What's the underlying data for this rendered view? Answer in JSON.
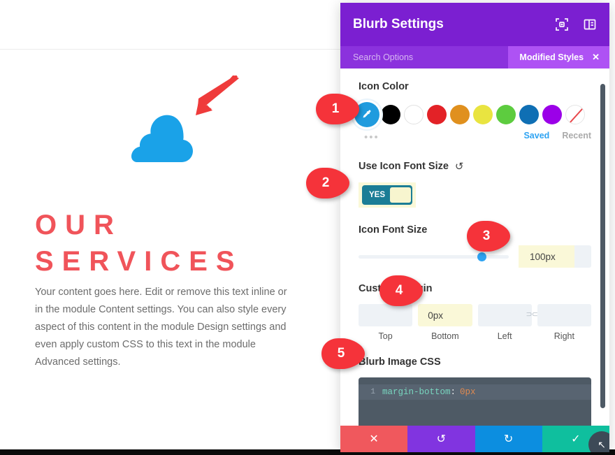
{
  "page": {
    "heading": "OUR SERVICES",
    "heading_line1": "OUR",
    "heading_line2": "SERVICES",
    "body": "Your content goes here. Edit or remove this text inline or in the module Content settings. You can also style every aspect of this content in the module Design settings and even apply custom CSS to this text in the module Advanced settings.",
    "heading_color": "#f0545a",
    "icon_name": "cloud-icon",
    "icon_color": "#1aa2e8"
  },
  "panel": {
    "title": "Blurb Settings",
    "header_color": "#7b1fd1",
    "icons": [
      {
        "name": "expand-icon"
      },
      {
        "name": "layout-columns-icon"
      }
    ],
    "search_placeholder": "Search Options",
    "modified_styles_label": "Modified Styles",
    "modified_styles_close": "✕"
  },
  "icon_color": {
    "label": "Icon Color",
    "swatches": [
      {
        "name": "eyedropper-selected",
        "color": "#1f9bde",
        "selected": true
      },
      {
        "name": "black",
        "color": "#000000"
      },
      {
        "name": "white",
        "color": "#ffffff"
      },
      {
        "name": "red",
        "color": "#e32227"
      },
      {
        "name": "orange",
        "color": "#e0901e"
      },
      {
        "name": "yellow",
        "color": "#e9e440"
      },
      {
        "name": "green",
        "color": "#5dcc3f"
      },
      {
        "name": "blue",
        "color": "#0f6fb4"
      },
      {
        "name": "purple",
        "color": "#9b00e8"
      },
      {
        "name": "none",
        "color": "#ffffff"
      }
    ],
    "more_dots": "•••",
    "saved_label": "Saved",
    "recent_label": "Recent"
  },
  "use_icon_font_size": {
    "label": "Use Icon Font Size",
    "reset_icon": "↺",
    "toggle_value": "YES"
  },
  "icon_font_size": {
    "label": "Icon Font Size",
    "value": "100px",
    "slider_percent": 82
  },
  "custom_margin": {
    "label": "Custom Margin",
    "fields": [
      {
        "caption": "Top",
        "value": "",
        "highlighted": false
      },
      {
        "caption": "Bottom",
        "value": "0px",
        "highlighted": true
      },
      {
        "caption": "Left",
        "value": "",
        "highlighted": false
      },
      {
        "caption": "Right",
        "value": "",
        "highlighted": false
      }
    ],
    "link_icon": "⊃⊂"
  },
  "blurb_image_css": {
    "label": "Blurb Image CSS",
    "line_number": "1",
    "property": "margin-bottom",
    "colon": ":",
    "value": "0px"
  },
  "footer": {
    "buttons": [
      {
        "name": "cancel-button",
        "glyph": "✕",
        "color": "#f0585d"
      },
      {
        "name": "undo-button",
        "glyph": "↺",
        "color": "#8134e0"
      },
      {
        "name": "redo-button",
        "glyph": "↻",
        "color": "#0c8ee0"
      },
      {
        "name": "save-button",
        "glyph": "✓",
        "color": "#0fbf9e"
      }
    ]
  },
  "markers": [
    {
      "number": "1"
    },
    {
      "number": "2"
    },
    {
      "number": "3"
    },
    {
      "number": "4"
    },
    {
      "number": "5"
    }
  ],
  "resize_handle_glyph": "↖"
}
